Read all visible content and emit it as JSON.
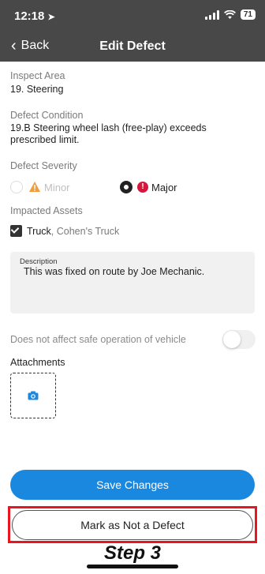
{
  "status_bar": {
    "time": "12:18",
    "battery": "71"
  },
  "nav": {
    "back_label": "Back",
    "title": "Edit Defect"
  },
  "form": {
    "inspect_area": {
      "label": "Inspect Area",
      "value": "19. Steering"
    },
    "defect_condition": {
      "label": "Defect Condition",
      "value_line1": "19.B Steering wheel lash (free-play) exceeds",
      "value_line2": "prescribed limit."
    },
    "defect_severity": {
      "label": "Defect Severity",
      "options": [
        {
          "label": "Minor",
          "selected": false
        },
        {
          "label": "Major",
          "selected": true
        }
      ]
    },
    "impacted_assets": {
      "label": "Impacted Assets",
      "asset_name": "Truck",
      "asset_detail": ", Cohen's Truck",
      "checked": true
    },
    "description": {
      "label": "Description",
      "value": "This was fixed on route by Joe Mechanic."
    },
    "safe_operation": {
      "label": "Does not affect safe operation of vehicle",
      "enabled": false
    },
    "attachments": {
      "label": "Attachments"
    }
  },
  "buttons": {
    "save_label": "Save Changes",
    "mark_label": "Mark as Not a Defect"
  },
  "annotation": {
    "step_label": "Step 3",
    "highlight_color": "#e8161e"
  },
  "colors": {
    "header_bg": "#484848",
    "primary": "#1b88e0",
    "major": "#d6163e",
    "minor": "#f39c3a"
  },
  "icons": [
    "location-arrow-icon",
    "signal-icon",
    "wifi-icon",
    "battery-icon",
    "chevron-left-icon",
    "warning-triangle-icon",
    "exclamation-circle-icon",
    "camera-icon"
  ]
}
